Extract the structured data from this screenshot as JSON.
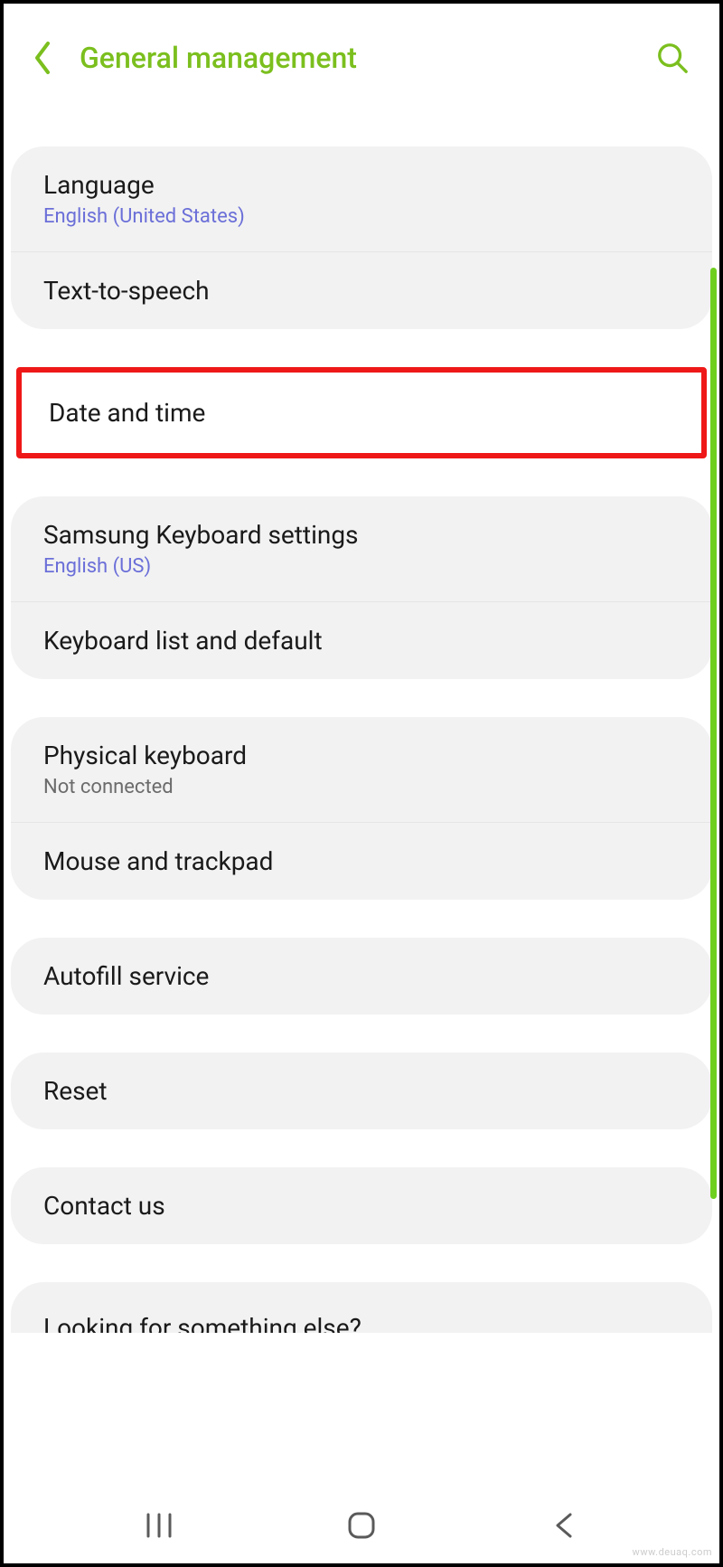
{
  "header": {
    "title": "General management"
  },
  "groups": [
    {
      "type": "card",
      "items": [
        {
          "title": "Language",
          "subtitle": "English (United States)",
          "sub_style": "blue"
        },
        {
          "title": "Text-to-speech"
        }
      ]
    },
    {
      "type": "highlight",
      "items": [
        {
          "title": "Date and time"
        }
      ]
    },
    {
      "type": "card",
      "items": [
        {
          "title": "Samsung Keyboard settings",
          "subtitle": "English (US)",
          "sub_style": "blue"
        },
        {
          "title": "Keyboard list and default"
        }
      ]
    },
    {
      "type": "card",
      "items": [
        {
          "title": "Physical keyboard",
          "subtitle": "Not connected",
          "sub_style": "gray"
        },
        {
          "title": "Mouse and trackpad"
        }
      ]
    },
    {
      "type": "card",
      "items": [
        {
          "title": "Autofill service"
        }
      ]
    },
    {
      "type": "card",
      "items": [
        {
          "title": "Reset"
        }
      ]
    },
    {
      "type": "card",
      "items": [
        {
          "title": "Contact us"
        }
      ]
    }
  ],
  "partial_row": {
    "title": "Looking for something else?"
  },
  "watermark": "www.deuaq.com",
  "colors": {
    "accent": "#7bbf1e",
    "highlight_border": "#ef1818",
    "subtitle_blue": "#6b6fd8"
  }
}
